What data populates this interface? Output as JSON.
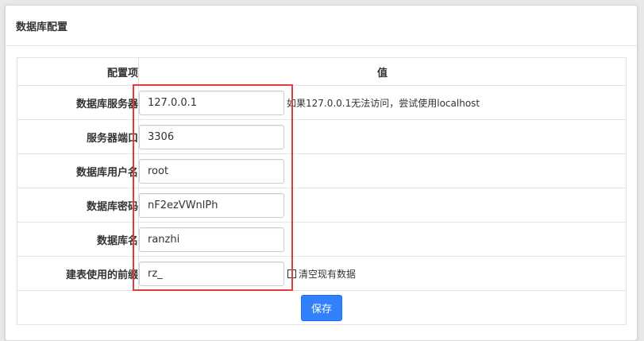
{
  "panel": {
    "title": "数据库配置"
  },
  "table": {
    "headers": {
      "item": "配置项",
      "value": "值"
    },
    "rows": [
      {
        "label": "数据库服务器",
        "value": "127.0.0.1",
        "hint": "如果127.0.0.1无法访问，尝试使用localhost"
      },
      {
        "label": "服务器端口",
        "value": "3306"
      },
      {
        "label": "数据库用户名",
        "value": "root"
      },
      {
        "label": "数据库密码",
        "value": "nF2ezVWnlPh"
      },
      {
        "label": "数据库名",
        "value": "ranzhi"
      },
      {
        "label": "建表使用的前缀",
        "value": "rz_",
        "checkbox_label": "清空现有数据",
        "checkbox_checked": false
      }
    ]
  },
  "actions": {
    "save_label": "保存"
  },
  "colors": {
    "primary": "#3280fc",
    "highlight": "#e23b3b"
  }
}
